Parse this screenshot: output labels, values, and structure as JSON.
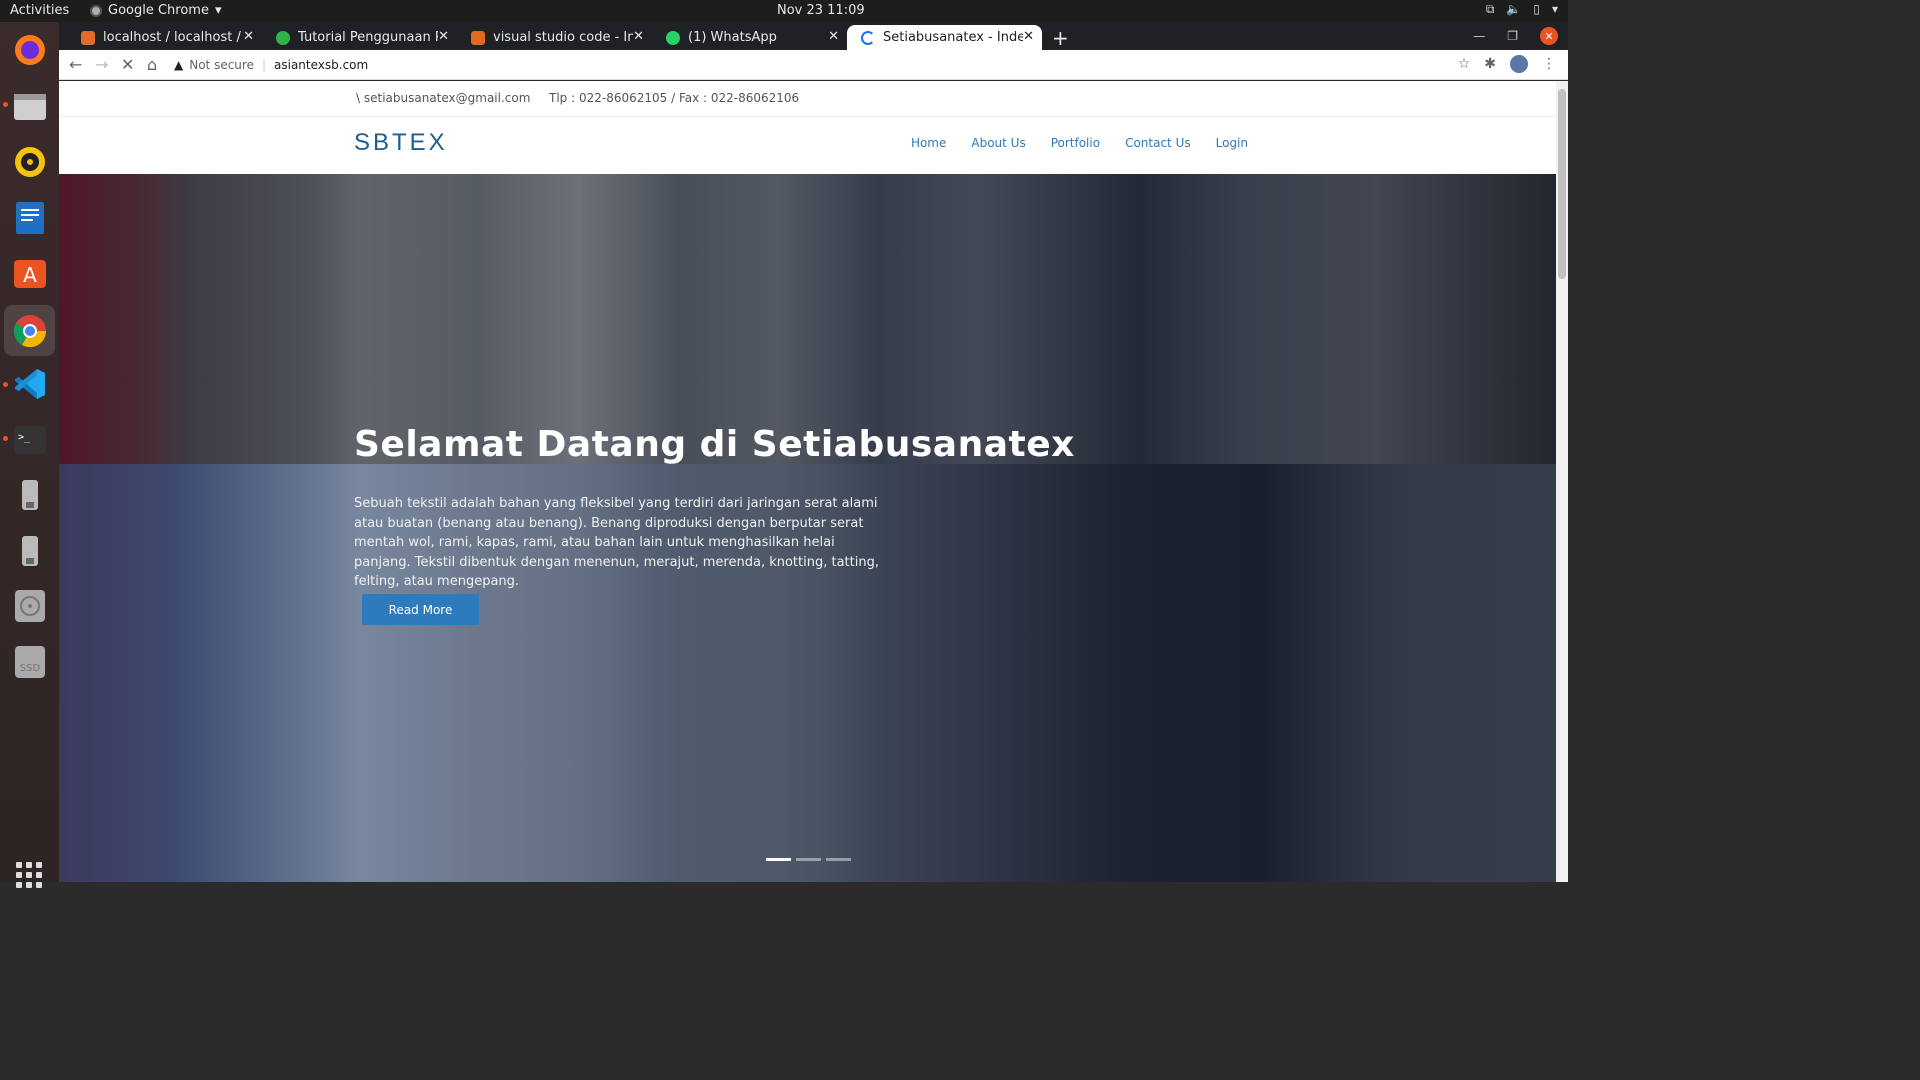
{
  "topbar": {
    "activities": "Activities",
    "app_name": "Google Chrome",
    "clock": "Nov 23  11:09"
  },
  "tabs": [
    {
      "label": "localhost / localhost / ma",
      "favicon_color": "#e06d2c",
      "active": false
    },
    {
      "label": "Tutorial Penggunaan Per",
      "favicon_color": "#2db548",
      "active": false
    },
    {
      "label": "visual studio code - Insuff",
      "favicon_color": "#e2681f",
      "active": false
    },
    {
      "label": "(1) WhatsApp",
      "favicon_color": "#25d366",
      "active": false
    },
    {
      "label": "Setiabusanatex - Index",
      "favicon_color": "#1a73e8",
      "active": true
    }
  ],
  "address": {
    "security": "Not secure",
    "url": "asiantexsb.com"
  },
  "site": {
    "email": "\\ setiabusanatex@gmail.com",
    "phone": "Tlp : 022-86062105 / Fax : 022-86062106",
    "brand": "SBTEX",
    "menu": [
      "Home",
      "About Us",
      "Portfolio",
      "Contact Us",
      "Login"
    ]
  },
  "hero": {
    "title": "Selamat Datang di Setiabusanatex",
    "text": "Sebuah tekstil adalah bahan yang fleksibel yang terdiri dari jaringan serat alami atau buatan (benang atau benang). Benang diproduksi dengan berputar serat mentah wol, rami, kapas, rami, atau bahan lain untuk menghasilkan helai panjang. Tekstil dibentuk dengan menenun, merajut, merenda, knotting, tatting, felting, atau mengepang.",
    "button": "Read More",
    "slides": 3,
    "active_slide": 1
  },
  "colors": {
    "accent": "#2d7bbd",
    "brand": "#1f5e8e"
  }
}
